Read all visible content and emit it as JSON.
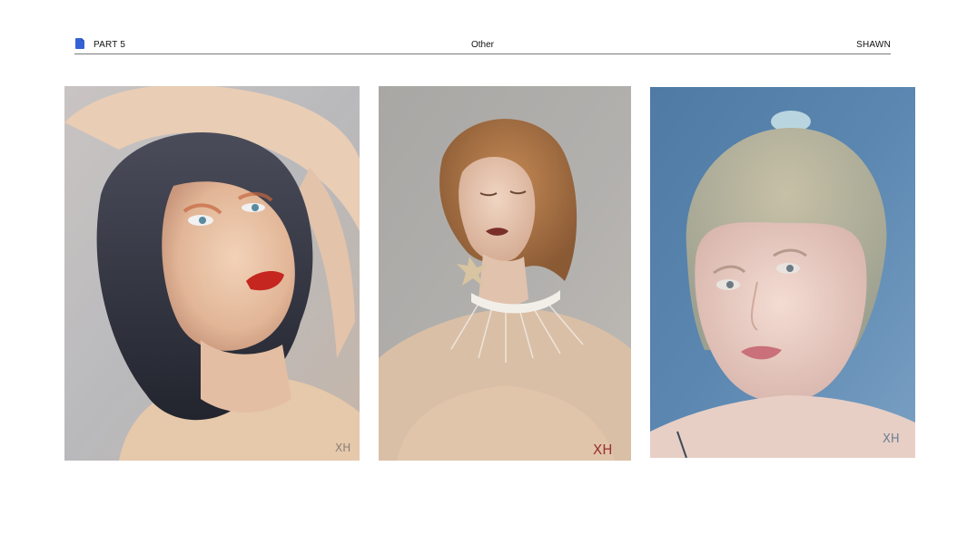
{
  "header": {
    "icon": "document-icon",
    "part_label": "PART 5",
    "title": "Other",
    "author": "SHAWN"
  },
  "artworks": [
    {
      "signature": "XH"
    },
    {
      "signature": "XH"
    },
    {
      "signature": "XH"
    }
  ],
  "colors": {
    "icon_blue": "#3462d6",
    "rule": "#7a7a7a",
    "text": "#111111"
  }
}
